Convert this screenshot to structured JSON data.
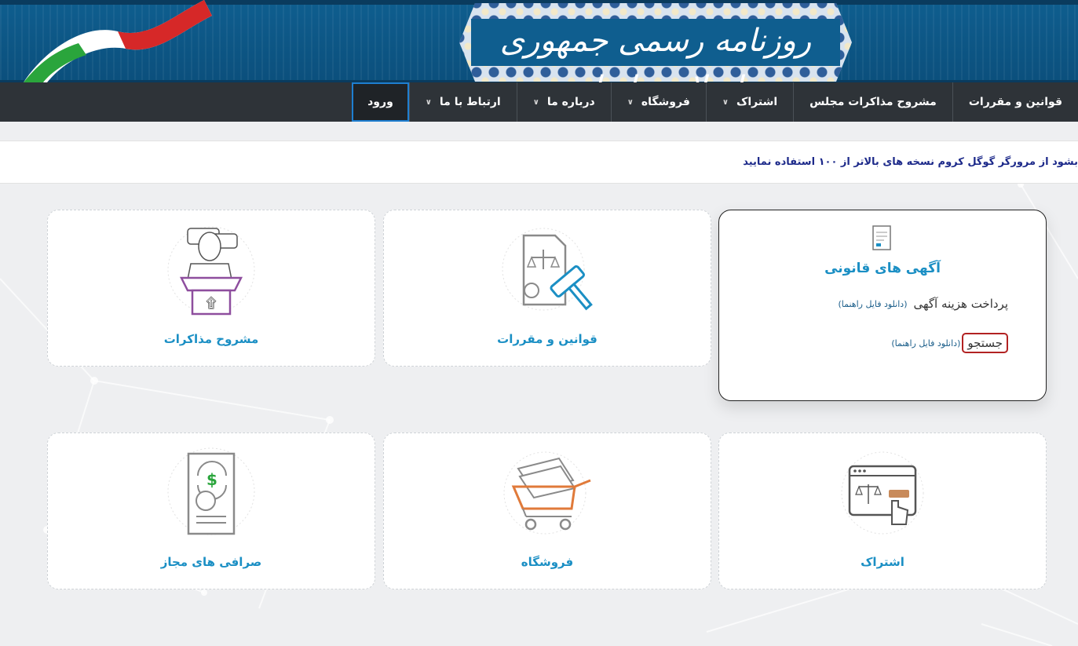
{
  "header": {
    "title": "روزنامه رسمی جمهوری اسلامی ایران"
  },
  "nav": {
    "items": [
      {
        "label": "قوانین و مقررات",
        "has_dropdown": false
      },
      {
        "label": "مشروح مذاکرات مجلس",
        "has_dropdown": false
      },
      {
        "label": "اشتراک",
        "has_dropdown": true
      },
      {
        "label": "فروشگاه",
        "has_dropdown": true
      },
      {
        "label": "درباره ما",
        "has_dropdown": true
      },
      {
        "label": "ارتباط با ما",
        "has_dropdown": true
      },
      {
        "label": "ورود",
        "has_dropdown": false
      }
    ]
  },
  "notice": {
    "text": "بشود از مرورگر گوگل کروم نسخه های بالاتر از ۱۰۰ استفاده نمایید"
  },
  "cards": {
    "legal_ads": {
      "title": "آگهی های قانونی",
      "payment_label": "پرداخت هزینه آگهی",
      "payment_guide": "(دانلود فایل راهنما)",
      "search_label": "جستجو",
      "search_guide": "(دانلود فایل راهنما)"
    },
    "laws": {
      "label": "قوانین و مقررات",
      "icon": "gavel-document-icon"
    },
    "debates": {
      "label": "مشروح مذاکرات",
      "icon": "speaker-podium-icon"
    },
    "subscription": {
      "label": "اشتراک",
      "icon": "browser-click-icon"
    },
    "shop": {
      "label": "فروشگاه",
      "icon": "shopping-cart-icon"
    },
    "exchanges": {
      "label": "صرافی های مجاز",
      "icon": "currency-document-icon"
    }
  },
  "colors": {
    "header_bg": "#0f5e8f",
    "nav_bg": "#2e3338",
    "accent": "#1b8fc4",
    "notice_text": "#1d2a8a",
    "search_highlight": "#b22222"
  }
}
